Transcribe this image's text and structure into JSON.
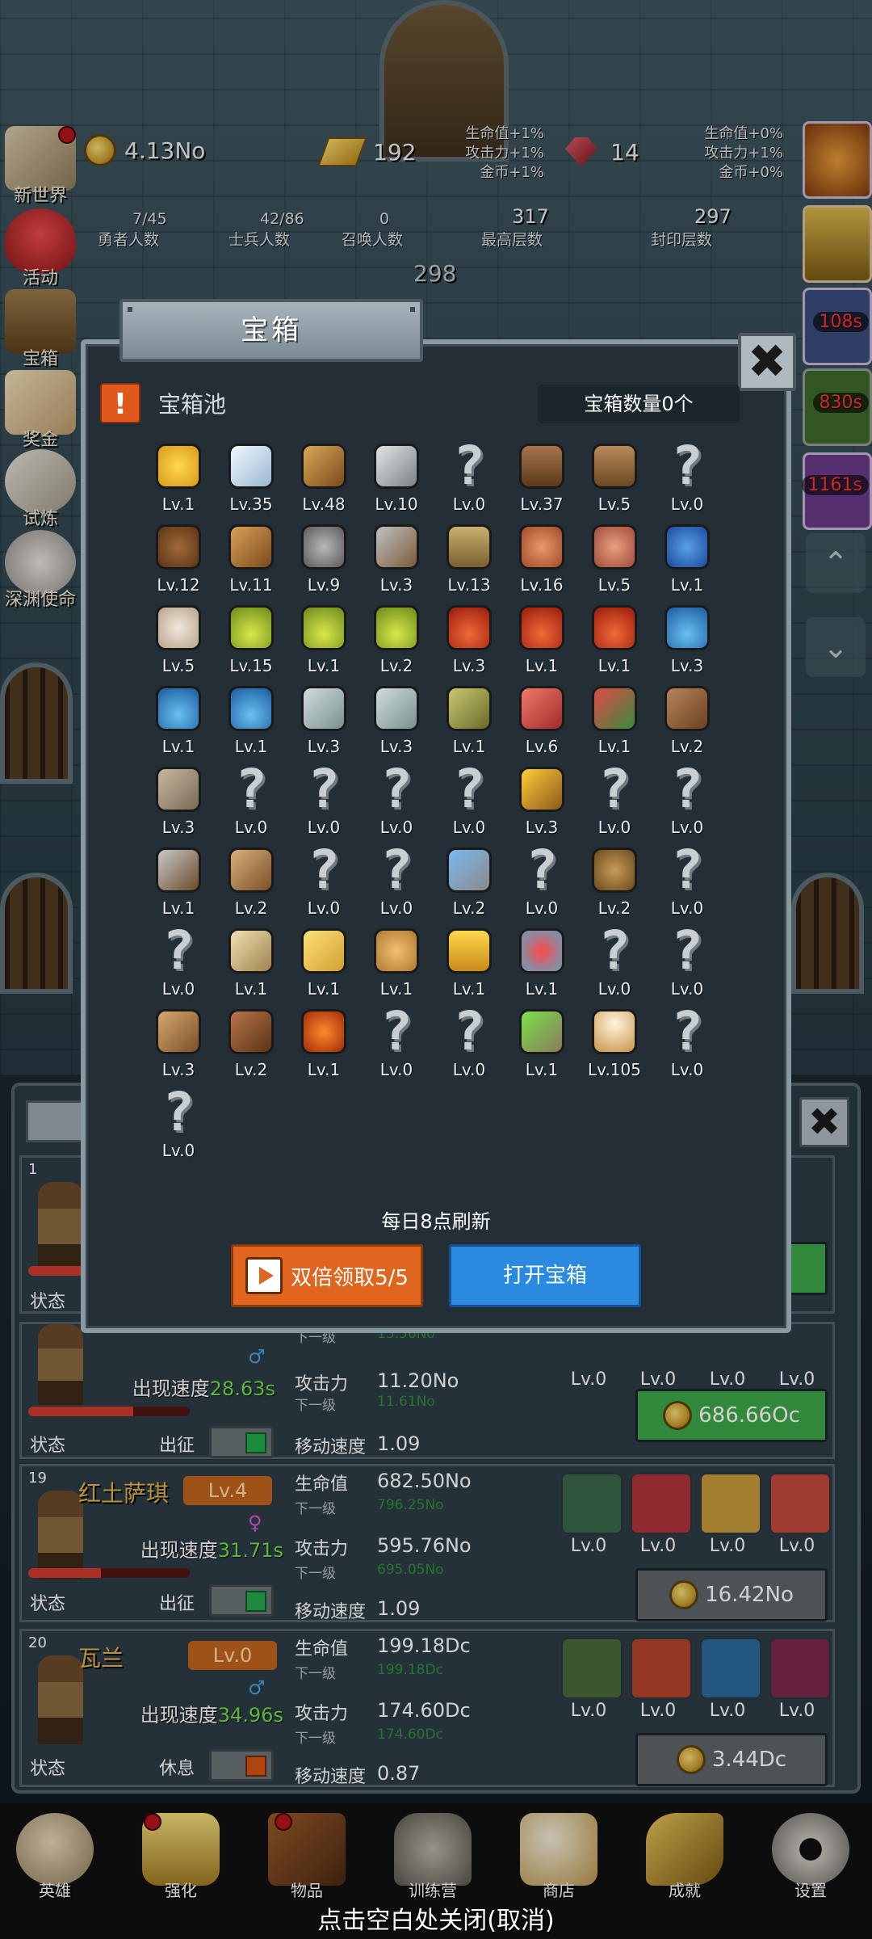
{
  "hud": {
    "world_label": "新世界",
    "coins": "4.13No",
    "gold": "192",
    "buffs_left": [
      "生命值+1%",
      "攻击力+1%",
      "金币+1%"
    ],
    "gems": "14",
    "buffs_right": [
      "生命值+0%",
      "攻击力+1%",
      "金币+0%"
    ],
    "hero_count_value": "7/45",
    "hero_count_label": "勇者人数",
    "soldier_value": "42/86",
    "soldier_label": "士兵人数",
    "summon_value": "0",
    "summon_label": "召唤人数",
    "max_floor_value": "317",
    "max_floor_label": "最高层数",
    "sealed_value": "297",
    "sealed_label": "封印层数",
    "current_floor": "298"
  },
  "side_menu": [
    {
      "label": "活动"
    },
    {
      "label": "宝箱"
    },
    {
      "label": "奖金"
    },
    {
      "label": "试炼"
    },
    {
      "label": "深渊使命"
    }
  ],
  "right_timers": [
    "108s",
    "830s",
    "1161s"
  ],
  "modal": {
    "title": "宝箱",
    "pool_title": "宝箱池",
    "count_label": "宝箱数量0个",
    "refresh_note": "每日8点刷新",
    "double_button": "双倍领取5/5",
    "open_button": "打开宝箱",
    "items": [
      {
        "icon": "crown",
        "lv": "Lv.1"
      },
      {
        "icon": "diamond",
        "lv": "Lv.35"
      },
      {
        "icon": "sword",
        "lv": "Lv.48"
      },
      {
        "icon": "sword-gray",
        "lv": "Lv.10"
      },
      {
        "icon": "unknown",
        "lv": "Lv.0"
      },
      {
        "icon": "armor",
        "lv": "Lv.37"
      },
      {
        "icon": "backpack",
        "lv": "Lv.5"
      },
      {
        "icon": "unknown",
        "lv": "Lv.0"
      },
      {
        "icon": "helmet-leather",
        "lv": "Lv.12"
      },
      {
        "icon": "dagger",
        "lv": "Lv.11"
      },
      {
        "icon": "knight-helmet",
        "lv": "Lv.9"
      },
      {
        "icon": "hammer",
        "lv": "Lv.3"
      },
      {
        "icon": "great-helm",
        "lv": "Lv.13"
      },
      {
        "icon": "meat-leg",
        "lv": "Lv.16"
      },
      {
        "icon": "steak",
        "lv": "Lv.5"
      },
      {
        "icon": "blue-bag",
        "lv": "Lv.1"
      },
      {
        "icon": "rice-bowl",
        "lv": "Lv.5"
      },
      {
        "icon": "potion-yellow",
        "lv": "Lv.15"
      },
      {
        "icon": "potion-yellow",
        "lv": "Lv.1"
      },
      {
        "icon": "potion-yellow",
        "lv": "Lv.2"
      },
      {
        "icon": "potion-red",
        "lv": "Lv.3"
      },
      {
        "icon": "potion-red",
        "lv": "Lv.1"
      },
      {
        "icon": "potion-red",
        "lv": "Lv.1"
      },
      {
        "icon": "potion-blue",
        "lv": "Lv.3"
      },
      {
        "icon": "potion-blue",
        "lv": "Lv.1"
      },
      {
        "icon": "potion-blue",
        "lv": "Lv.1"
      },
      {
        "icon": "bottle-gray",
        "lv": "Lv.3"
      },
      {
        "icon": "bottle-gray",
        "lv": "Lv.3"
      },
      {
        "icon": "bottle-green",
        "lv": "Lv.1"
      },
      {
        "icon": "bottle-red",
        "lv": "Lv.6"
      },
      {
        "icon": "winged-boot",
        "lv": "Lv.1"
      },
      {
        "icon": "boot",
        "lv": "Lv.2"
      },
      {
        "icon": "boot-gray",
        "lv": "Lv.3"
      },
      {
        "icon": "unknown",
        "lv": "Lv.0"
      },
      {
        "icon": "unknown",
        "lv": "Lv.0"
      },
      {
        "icon": "unknown",
        "lv": "Lv.0"
      },
      {
        "icon": "unknown",
        "lv": "Lv.0"
      },
      {
        "icon": "torch",
        "lv": "Lv.3"
      },
      {
        "icon": "unknown",
        "lv": "Lv.0"
      },
      {
        "icon": "unknown",
        "lv": "Lv.0"
      },
      {
        "icon": "pickaxe",
        "lv": "Lv.1"
      },
      {
        "icon": "staff",
        "lv": "Lv.2"
      },
      {
        "icon": "unknown",
        "lv": "Lv.0"
      },
      {
        "icon": "unknown",
        "lv": "Lv.0"
      },
      {
        "icon": "wand-blue",
        "lv": "Lv.2"
      },
      {
        "icon": "unknown",
        "lv": "Lv.0"
      },
      {
        "icon": "big-bag",
        "lv": "Lv.2"
      },
      {
        "icon": "unknown",
        "lv": "Lv.0"
      },
      {
        "icon": "unknown",
        "lv": "Lv.0"
      },
      {
        "icon": "club",
        "lv": "Lv.1"
      },
      {
        "icon": "cheese",
        "lv": "Lv.1"
      },
      {
        "icon": "pie",
        "lv": "Lv.1"
      },
      {
        "icon": "honey-jar",
        "lv": "Lv.1"
      },
      {
        "icon": "red-orb",
        "lv": "Lv.1"
      },
      {
        "icon": "unknown",
        "lv": "Lv.0"
      },
      {
        "icon": "unknown",
        "lv": "Lv.0"
      },
      {
        "icon": "bow",
        "lv": "Lv.3"
      },
      {
        "icon": "quiver",
        "lv": "Lv.2"
      },
      {
        "icon": "fire-scroll",
        "lv": "Lv.1"
      },
      {
        "icon": "unknown",
        "lv": "Lv.0"
      },
      {
        "icon": "unknown",
        "lv": "Lv.0"
      },
      {
        "icon": "wand-green",
        "lv": "Lv.1"
      },
      {
        "icon": "beer-mug",
        "lv": "Lv.105"
      },
      {
        "icon": "unknown",
        "lv": "Lv.0"
      },
      {
        "icon": "unknown",
        "lv": "Lv.0"
      }
    ]
  },
  "heroes": [
    {
      "num": "",
      "name": "",
      "lv": "",
      "speed_label": "",
      "speed": "",
      "state_label": "状态",
      "action": "",
      "hp_fill": 0.3,
      "upgrade_price": "c",
      "next_label": "下一级",
      "next_hp": "13.56No",
      "atk_label": "攻击力",
      "atk": "11.20No",
      "next_atk": "11.61No",
      "move_label": "移动速度",
      "move": "1.09",
      "skill_lvs": [
        "Lv.0",
        "Lv.0",
        "Lv.0",
        "Lv.0"
      ],
      "price": "686.66Oc",
      "speed2_label": "出现速度",
      "speed2": "28.63s",
      "state2": "状态",
      "action2": "出征"
    },
    {
      "num": "19",
      "name": "红土萨琪",
      "lv": "Lv.4",
      "speed_label": "出现速度",
      "speed": "31.71s",
      "state_label": "状态",
      "action": "出征",
      "hp_fill": 0.45,
      "hp_label": "生命值",
      "hp": "682.50No",
      "next_label": "下一级",
      "next_hp": "796.25No",
      "atk_label": "攻击力",
      "atk": "595.76No",
      "next_atk": "695.05No",
      "move_label": "移动速度",
      "move": "1.09",
      "skill_lvs": [
        "Lv.0",
        "Lv.0",
        "Lv.0",
        "Lv.0"
      ],
      "price": "16.42No"
    },
    {
      "num": "20",
      "name": "瓦兰",
      "lv": "Lv.0",
      "speed_label": "出现速度",
      "speed": "34.96s",
      "state_label": "状态",
      "action": "休息",
      "hp_label": "生命值",
      "hp": "199.18Dc",
      "next_label": "下一级",
      "next_hp": "199.18Dc",
      "atk_label": "攻击力",
      "atk": "174.60Dc",
      "next_atk": "174.60Dc",
      "move_label": "移动速度",
      "move": "0.87",
      "skill_lvs": [
        "Lv.0",
        "Lv.0",
        "Lv.0",
        "Lv.0"
      ],
      "price": "3.44Dc"
    }
  ],
  "hero1": {
    "num": "1",
    "state": "状态"
  },
  "bottom_nav": [
    {
      "label": "英雄"
    },
    {
      "label": "强化"
    },
    {
      "label": "物品"
    },
    {
      "label": "训练营"
    },
    {
      "label": "商店"
    },
    {
      "label": "成就"
    },
    {
      "label": "设置"
    }
  ],
  "close_hint": "点击空白处关闭(取消)",
  "colors": {
    "accent_orange": "#e0651f",
    "accent_blue": "#2a8ae0",
    "green_value": "#6ee24c",
    "hero_name": "#e4b24a"
  }
}
